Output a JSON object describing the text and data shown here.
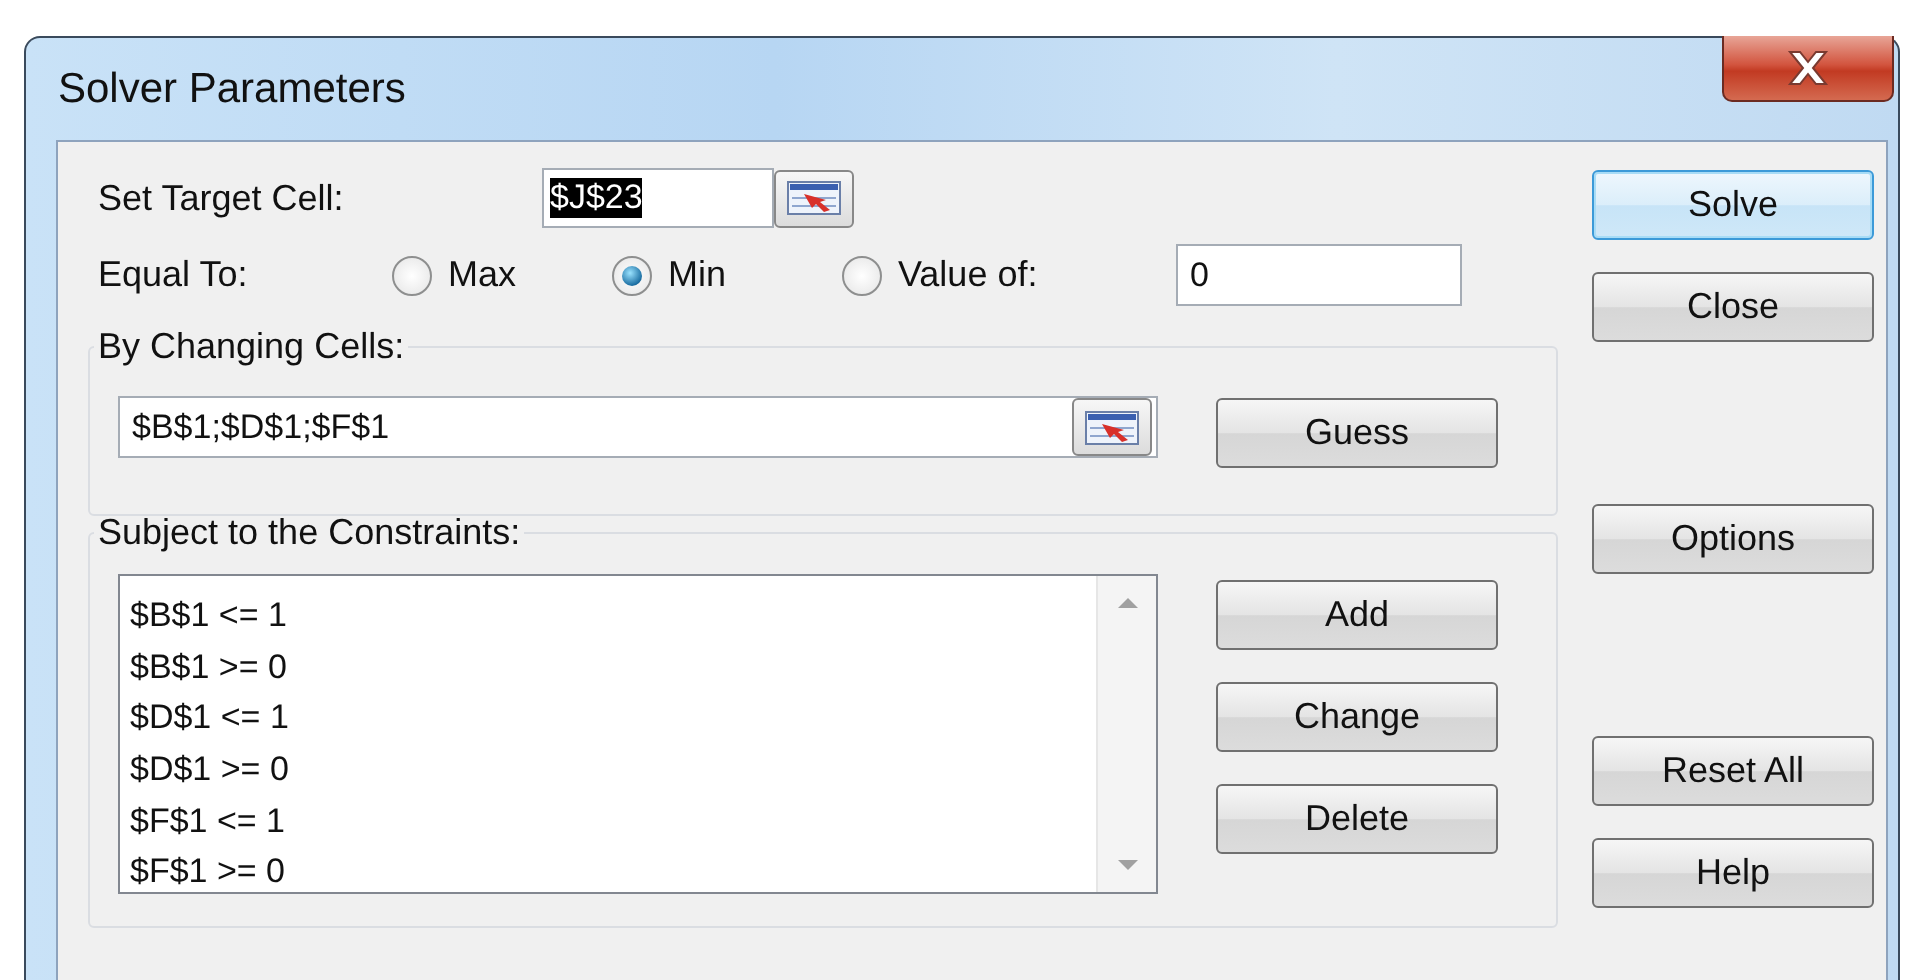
{
  "window": {
    "title": "Solver Parameters"
  },
  "target_cell": {
    "label": "Set Target Cell:",
    "value": "$J$23",
    "text_selected": true
  },
  "equal_to": {
    "label": "Equal To:",
    "options": [
      {
        "label": "Max",
        "selected": false
      },
      {
        "label": "Min",
        "selected": true
      },
      {
        "label": "Value of:",
        "selected": false
      }
    ],
    "value": "0"
  },
  "changing_cells": {
    "label": "By Changing Cells:",
    "value": "$B$1;$D$1;$F$1",
    "button": "Guess"
  },
  "constraints": {
    "label": "Subject to the Constraints:",
    "items": [
      "$B$1 <= 1",
      "$B$1 >= 0",
      "$D$1 <= 1",
      "$D$1 >= 0",
      "$F$1 <= 1",
      "$F$1 >= 0"
    ],
    "buttons": [
      "Add",
      "Change",
      "Delete"
    ]
  },
  "side_button_groups": [
    {
      "buttons": [
        {
          "label": "Solve",
          "focused": true
        },
        {
          "label": "Close",
          "focused": false
        }
      ]
    },
    {
      "buttons": [
        {
          "label": "Options",
          "focused": false
        }
      ]
    },
    {
      "buttons": [
        {
          "label": "Reset All",
          "focused": false
        },
        {
          "label": "Help",
          "focused": false
        }
      ]
    }
  ]
}
